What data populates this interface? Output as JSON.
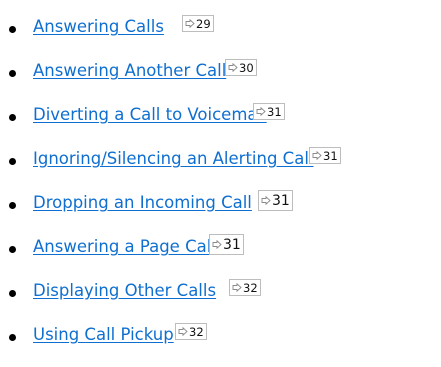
{
  "links": [
    {
      "label": "Answering Calls",
      "page": "29"
    },
    {
      "label": "Answering Another Call",
      "page": "30"
    },
    {
      "label": "Diverting a Call to Voicemail",
      "page": "31"
    },
    {
      "label": "Ignoring/Silencing an Alerting Call",
      "page": "31"
    },
    {
      "label": "Dropping an Incoming Call",
      "page": "31"
    },
    {
      "label": "Answering a Page Call",
      "page": "31"
    },
    {
      "label": "Displaying Other Calls",
      "page": "32"
    },
    {
      "label": "Using Call Pickup",
      "page": "32"
    }
  ],
  "colors": {
    "link": "#0f6fd0",
    "bullet": "#000000",
    "ref_border": "#bdbdbd"
  },
  "icons": {
    "page_ref": "arrow-right-icon"
  }
}
